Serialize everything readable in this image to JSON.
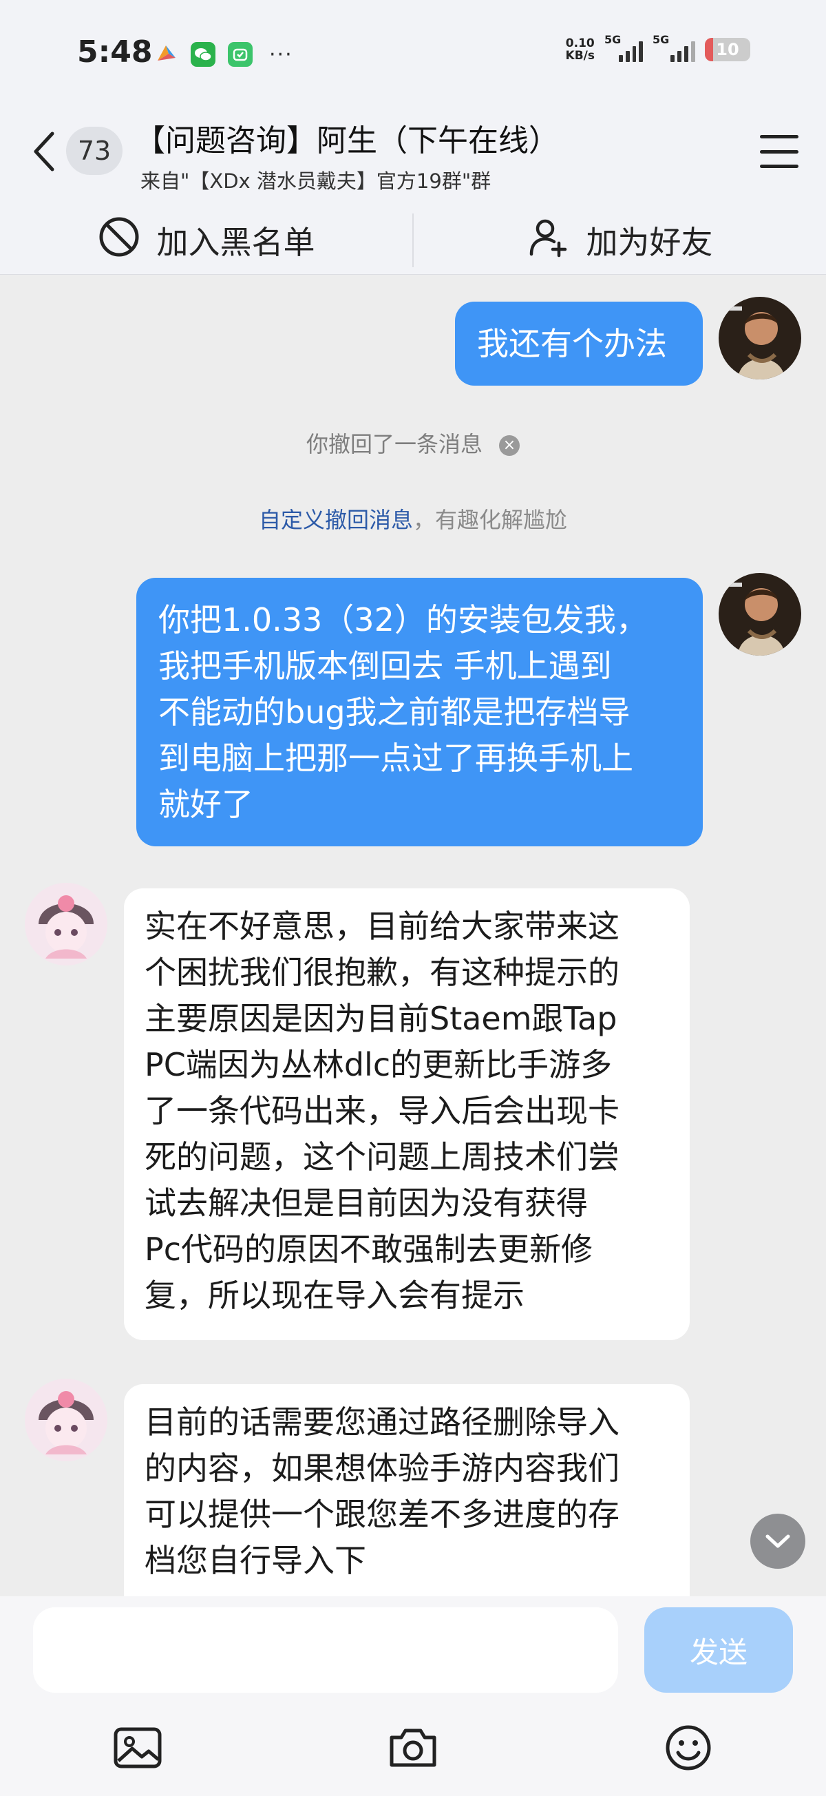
{
  "status": {
    "time": "5:48",
    "net_speed_value": "0.10",
    "net_speed_unit": "KB/s",
    "signal1_label": "5G",
    "signal2_label": "5G",
    "battery_level": "10",
    "icons": [
      "weather-icon",
      "wechat-icon",
      "mi-app-icon",
      "more-dots-icon"
    ]
  },
  "header": {
    "unread_count": "73",
    "title": "【问题咨询】阿生（下午在线）",
    "subtitle": "来自\"【XDx 潜水员戴夫】官方19群\"群"
  },
  "actions": {
    "blacklist_label": "加入黑名单",
    "add_friend_label": "加为好友"
  },
  "messages": {
    "m1": "我还有个办法",
    "recall_text": "你撤回了一条消息",
    "tip_link": "自定义撤回消息",
    "tip_rest": "，有趣化解尴尬",
    "m2": [
      "你把1.0.33（32）的安装包发我，",
      "我把手机版本倒回去 手机上遇到",
      "不能动的bug我之前都是把存档导",
      "到电脑上把那一点过了再换手机上",
      "就好了"
    ],
    "m3": [
      "实在不好意思，目前给大家带来这",
      "个困扰我们很抱歉，有这种提示的",
      "主要原因是因为目前Staem跟Tap",
      "PC端因为丛林dlc的更新比手游多",
      "了一条代码出来，导入后会出现卡",
      "死的问题，这个问题上周技术们尝",
      "试去解决但是目前因为没有获得",
      "Pc代码的原因不敢强制去更新修",
      "复，所以现在导入会有提示"
    ],
    "m4": [
      "目前的话需要您通过路径删除导入",
      "的内容，如果想体验手游内容我们",
      "可以提供一个跟您差不多进度的存",
      "档您自行导入下"
    ]
  },
  "input": {
    "value": "",
    "send_label": "发送"
  },
  "colors": {
    "outgoing_bubble": "#3f95f6",
    "send_button": "#a8d0fb",
    "link": "#2c5aa8"
  }
}
